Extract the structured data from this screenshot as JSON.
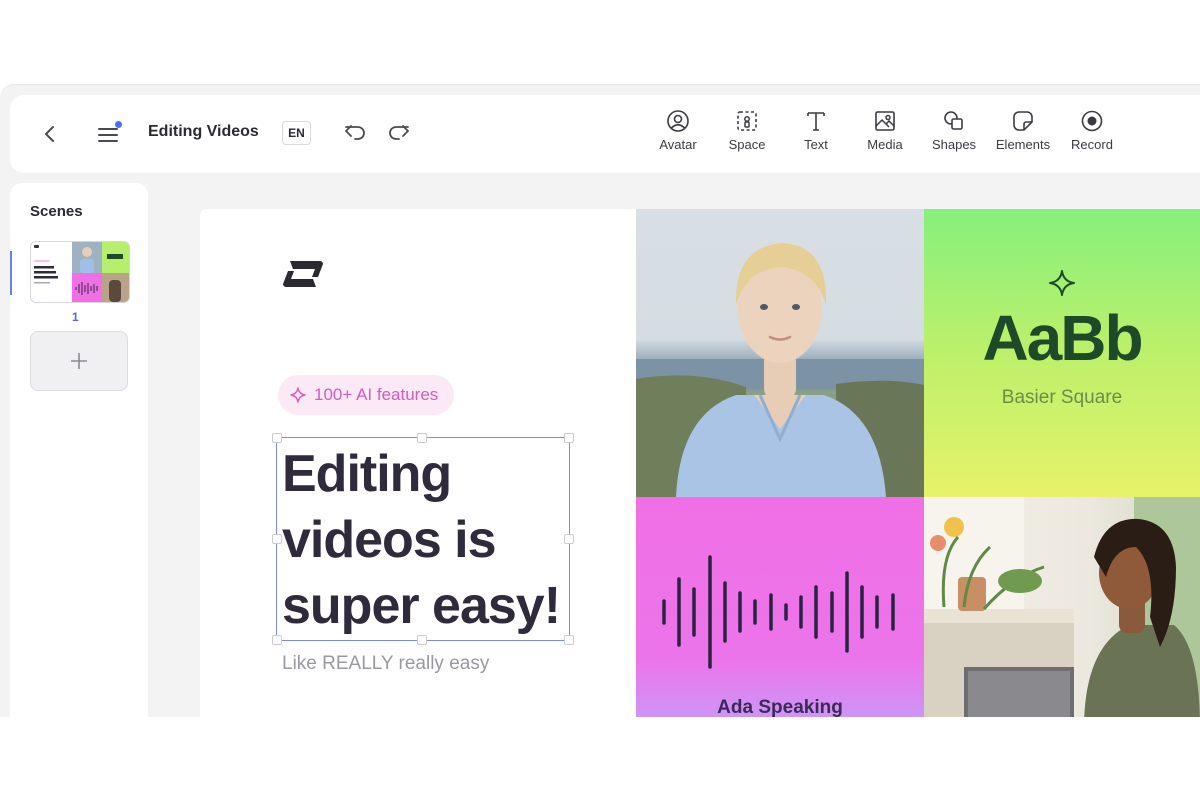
{
  "topbar": {
    "project_title": "Editing Videos",
    "language": "EN",
    "tools": [
      {
        "label": "Avatar",
        "icon": "avatar-icon"
      },
      {
        "label": "Space",
        "icon": "space-icon"
      },
      {
        "label": "Text",
        "icon": "text-icon"
      },
      {
        "label": "Media",
        "icon": "media-icon"
      },
      {
        "label": "Shapes",
        "icon": "shapes-icon"
      },
      {
        "label": "Elements",
        "icon": "elements-icon"
      },
      {
        "label": "Record",
        "icon": "record-icon"
      }
    ]
  },
  "scenes": {
    "title": "Scenes",
    "items": [
      {
        "number": "1"
      }
    ],
    "add_label": "+"
  },
  "canvas": {
    "badge": "100+ AI features",
    "headline": "Editing videos is super easy!",
    "subline": "Like REALLY really easy",
    "type_sample": "AaBb",
    "font_name": "Basier Square",
    "wave_caption": "Ada Speaking"
  },
  "colors": {
    "accent": "#4f6ef7",
    "badge_text": "#d35cc0",
    "type_tile": "#a8f06e",
    "wave_tile": "#f06fe6"
  }
}
